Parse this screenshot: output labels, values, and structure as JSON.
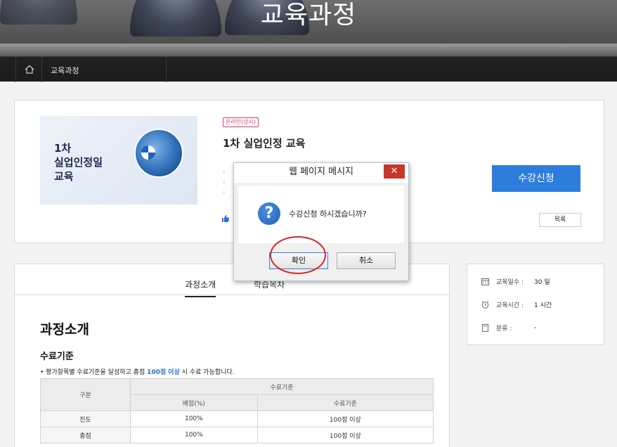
{
  "hero": {
    "title": "교육과정"
  },
  "breadcrumb": {
    "home_icon": "home-icon",
    "current": "교육과정"
  },
  "course": {
    "thumbnail_lines": [
      "1차",
      "실업인정일",
      "교육"
    ],
    "badge": "온라인(상시)",
    "title": "1차 실업인정 교육",
    "bullets": [
      "·",
      "·",
      "·"
    ],
    "like_icon": "thumbs-up-icon",
    "enroll_label": "수강신청",
    "list_label": "목록"
  },
  "tabs": [
    {
      "label": "과정소개",
      "active": true
    },
    {
      "label": "학습목차",
      "active": false
    }
  ],
  "intro": {
    "section_title": "과정소개",
    "criteria_title": "수료기준",
    "note_prefix": "• 평가항목별 수료기준을 달성하고 총점 ",
    "note_highlight": "100점 이상",
    "note_suffix": " 시 수료 가능합니다."
  },
  "criteria_table": {
    "col_group": "구분",
    "header_group": "수료기준",
    "sub_headers": [
      "배점(%)",
      "수료기준"
    ],
    "rows": [
      {
        "name": "진도",
        "score": "100%",
        "criteria": "100점 이상"
      },
      {
        "name": "총점",
        "score": "100%",
        "criteria": "100점 이상"
      }
    ]
  },
  "side_info": {
    "items": [
      {
        "icon": "calendar-icon",
        "label": "교육일수 :",
        "value": "30 일"
      },
      {
        "icon": "alarm-clock-icon",
        "label": "교육시간 :",
        "value": "1 시간"
      },
      {
        "icon": "document-icon",
        "label": "분류 :",
        "value": "-"
      }
    ]
  },
  "dialog": {
    "title": "웹 페이지 메시지",
    "close_label": "✕",
    "icon": "question-icon",
    "message": "수강신청 하시겠습니까?",
    "ok_label": "확인",
    "cancel_label": "취소"
  },
  "colors": {
    "accent": "#2d7ddc",
    "badge": "#e03a6a",
    "highlight": "#1f6fd6",
    "annotation": "#d7262a"
  }
}
